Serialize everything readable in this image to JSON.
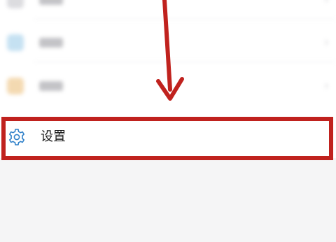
{
  "settings_item": {
    "label": "设置",
    "icon": "gear-icon"
  },
  "blurred_items": [
    {
      "icon": "app-icon",
      "icon_color": "#c8c8cc"
    },
    {
      "icon": "blue-item-icon",
      "icon_color": "#bcdcf0"
    },
    {
      "icon": "orange-item-icon",
      "icon_color": "#f2d3a4"
    }
  ],
  "colors": {
    "highlight": "#c0221e",
    "arrow": "#c0221e",
    "gear_icon": "#2f80c9",
    "background": "#f5f5f6"
  }
}
